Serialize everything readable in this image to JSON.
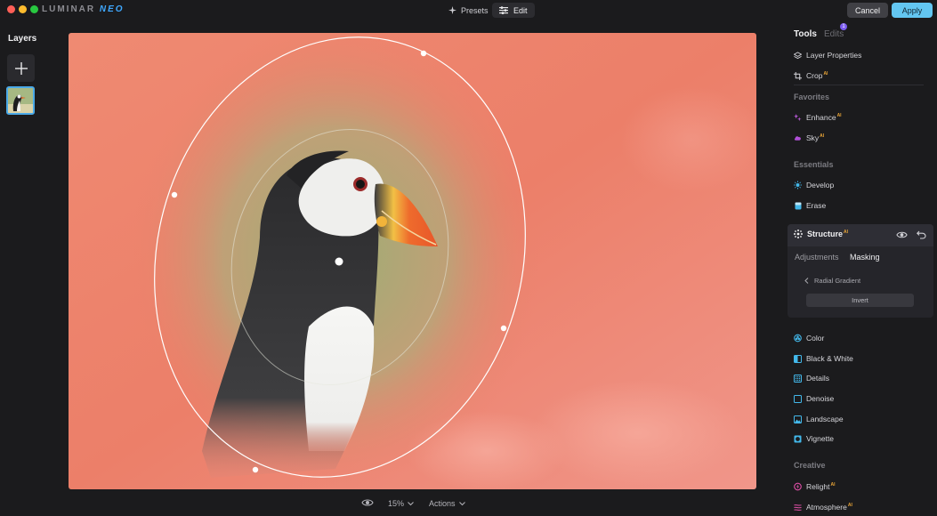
{
  "app": {
    "logo_main": "LUMINAR",
    "logo_accent": "NEO"
  },
  "topbar": {
    "presets_label": "Presets",
    "edit_label": "Edit",
    "cancel_label": "Cancel",
    "apply_label": "Apply"
  },
  "layers": {
    "title": "Layers"
  },
  "bottombar": {
    "zoom_label": "15%",
    "actions_label": "Actions"
  },
  "right_panel": {
    "tabs": [
      {
        "label": "Tools",
        "active": true
      },
      {
        "label": "Edits",
        "badge": "1"
      }
    ],
    "top_tools": [
      {
        "label": "Layer Properties",
        "icon": "layers-icon"
      },
      {
        "label": "Crop",
        "ai": "AI",
        "icon": "crop-icon"
      }
    ],
    "favorites_title": "Favorites",
    "favorites": [
      {
        "label": "Enhance",
        "ai": "AI",
        "icon": "sparkle-icon",
        "color": "#c05ce0"
      },
      {
        "label": "Sky",
        "ai": "AI",
        "icon": "cloud-icon",
        "color": "#b04fd8"
      }
    ],
    "essentials_title": "Essentials",
    "essentials": [
      {
        "label": "Develop",
        "icon": "sun-icon",
        "color": "#43b8ea"
      },
      {
        "label": "Erase",
        "icon": "eraser-icon",
        "color": "#43b8ea"
      }
    ],
    "structure": {
      "title": "Structure",
      "ai": "AI",
      "tabs": [
        "Adjustments",
        "Masking"
      ],
      "active_tab": "Masking",
      "mask_type": "Radial Gradient",
      "invert_label": "Invert"
    },
    "essentials_more": [
      {
        "label": "Color",
        "icon": "color-icon",
        "color": "#43b8ea"
      },
      {
        "label": "Black & White",
        "icon": "bw-icon",
        "color": "#43b8ea"
      },
      {
        "label": "Details",
        "icon": "details-icon",
        "color": "#43b8ea"
      },
      {
        "label": "Denoise",
        "icon": "denoise-icon",
        "color": "#43b8ea"
      },
      {
        "label": "Landscape",
        "icon": "landscape-icon",
        "color": "#43b8ea"
      },
      {
        "label": "Vignette",
        "icon": "vignette-icon",
        "color": "#43b8ea"
      }
    ],
    "creative_title": "Creative",
    "creative": [
      {
        "label": "Relight",
        "ai": "AI",
        "icon": "relight-icon",
        "color": "#e04fa8"
      },
      {
        "label": "Atmosphere",
        "ai": "AI",
        "icon": "atmosphere-icon",
        "color": "#e04fa8"
      }
    ]
  }
}
